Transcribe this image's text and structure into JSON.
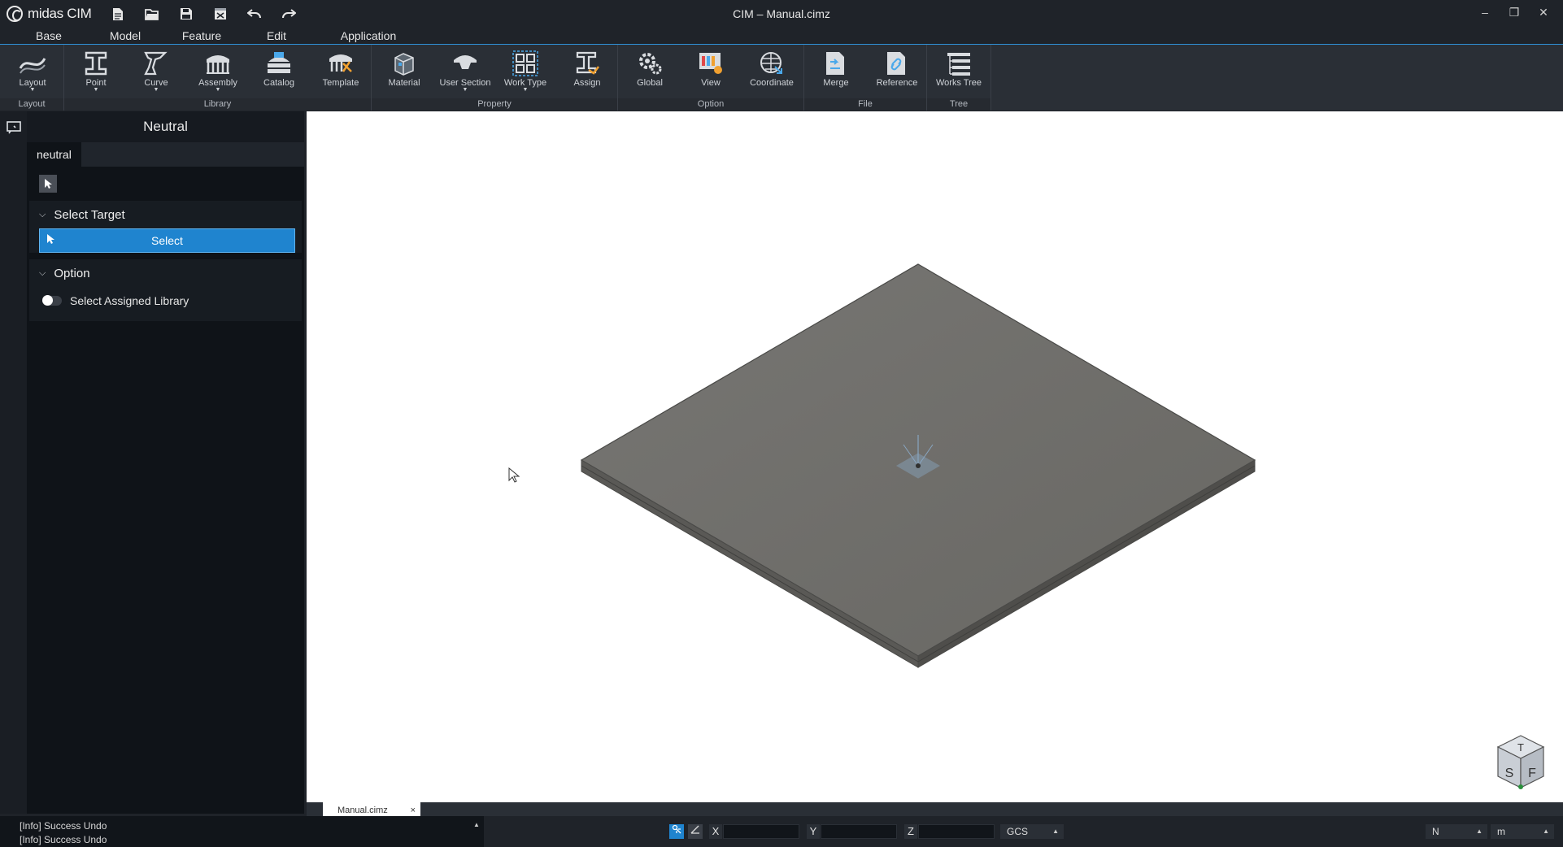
{
  "app": {
    "brand": "midas CIM",
    "window_title": "CIM – Manual.cimz"
  },
  "quick_access": [
    {
      "name": "new-file-icon",
      "glyph": "🗎"
    },
    {
      "name": "open-folder-icon",
      "glyph": "🗁"
    },
    {
      "name": "save-icon",
      "glyph": "💾"
    },
    {
      "name": "close-file-icon",
      "glyph": "☒"
    },
    {
      "name": "undo-icon",
      "glyph": "↶"
    },
    {
      "name": "redo-icon",
      "glyph": "↷"
    }
  ],
  "window_controls": {
    "minimize": "–",
    "restore": "❐",
    "close": "✕"
  },
  "menu_tabs": [
    {
      "label": "Base",
      "active": true
    },
    {
      "label": "Model"
    },
    {
      "label": "Feature"
    },
    {
      "label": "Edit"
    },
    {
      "label": "Application"
    }
  ],
  "ribbon": {
    "groups": [
      {
        "label": "Layout"
      },
      {
        "label": "Library"
      },
      {
        "label": "Property"
      },
      {
        "label": "Option"
      },
      {
        "label": "File"
      },
      {
        "label": "Tree"
      }
    ],
    "buttons": [
      {
        "label": "Layout",
        "icon": "layout-icon",
        "dropdown": true
      },
      {
        "label": "Point",
        "icon": "point-icon",
        "dropdown": true
      },
      {
        "label": "Curve",
        "icon": "curve-icon",
        "dropdown": true
      },
      {
        "label": "Assembly",
        "icon": "assembly-icon",
        "dropdown": true
      },
      {
        "label": "Catalog",
        "icon": "catalog-icon"
      },
      {
        "label": "Template",
        "icon": "template-icon"
      },
      {
        "label": "Material",
        "icon": "material-icon"
      },
      {
        "label": "User Section",
        "icon": "user-section-icon",
        "dropdown": true
      },
      {
        "label": "Work Type",
        "icon": "work-type-icon",
        "dropdown": true
      },
      {
        "label": "Assign",
        "icon": "assign-icon"
      },
      {
        "label": "Global",
        "icon": "global-icon"
      },
      {
        "label": "View",
        "icon": "view-icon"
      },
      {
        "label": "Coordinate",
        "icon": "coordinate-icon"
      },
      {
        "label": "Merge",
        "icon": "merge-icon"
      },
      {
        "label": "Reference",
        "icon": "reference-icon"
      },
      {
        "label": "Works Tree",
        "icon": "works-tree-icon"
      }
    ]
  },
  "panel": {
    "title": "Neutral",
    "tab": "neutral",
    "select_target": {
      "header": "Select Target",
      "button": "Select"
    },
    "option": {
      "header": "Option",
      "toggle_label": "Select Assigned Library",
      "toggle_on": false
    }
  },
  "document_tab": {
    "label": "Manual.cimz",
    "close": "×"
  },
  "status": {
    "log": [
      "[Info] Success Undo",
      "[Info] Success Undo"
    ],
    "coords": {
      "x_label": "X",
      "y_label": "Y",
      "z_label": "Z",
      "x": "",
      "y": "",
      "z": ""
    },
    "coord_system": "GCS",
    "force_unit": "N",
    "length_unit": "m"
  },
  "nav_cube": {
    "top": "T",
    "side": "S",
    "front": "F"
  },
  "colors": {
    "accent": "#1f84cf",
    "background": "#1f2329",
    "viewport": "#ffffff",
    "slab": "#6a6966"
  }
}
